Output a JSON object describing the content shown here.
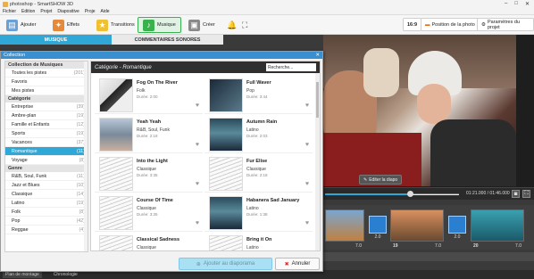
{
  "window": {
    "title": "photoshop - SmartSHOW 3D",
    "controls": [
      "–",
      "□",
      "✕"
    ]
  },
  "menu": [
    "Fichier",
    "Edition",
    "Projet",
    "Diapositive",
    "Proje",
    "Aide"
  ],
  "toolbar": {
    "buttons": [
      {
        "label": "Ajouter",
        "icon": "folder-icon"
      },
      {
        "label": "Effets",
        "icon": "effects-icon"
      },
      {
        "label": "Transitions",
        "icon": "transitions-icon"
      },
      {
        "label": "Musique",
        "icon": "music-icon"
      },
      {
        "label": "Créer",
        "icon": "create-icon"
      }
    ],
    "ratio": "16:9",
    "photo_position": "Position de la photo",
    "project_settings": "Paramètres du projet"
  },
  "subtabs": {
    "music": "MUSIQUE",
    "voice": "COMMENTAIRES SONORES"
  },
  "preview": {
    "edit_label": "Editer la diapo",
    "time": "01:21.000 / 01:46.000",
    "progress": 0.63
  },
  "timeline": {
    "slides": [
      {
        "num": "",
        "dur": "7.0"
      },
      {
        "num": "19",
        "dur": "7.0"
      },
      {
        "num": "20",
        "dur": "7.0"
      }
    ],
    "transitions": [
      "2.0",
      "2.0",
      "2.0"
    ]
  },
  "bottom_tabs": [
    "Plan de montage",
    "Chronologie"
  ],
  "dialog": {
    "title": "Collection",
    "close": "✕",
    "sections": [
      {
        "header": "Collection de Musiques",
        "items": [
          {
            "label": "Toutes les pistes",
            "count": "(201)"
          },
          {
            "label": "Favoris",
            "count": ""
          },
          {
            "label": "Mes pistes",
            "count": ""
          }
        ]
      },
      {
        "header": "Catégorie",
        "items": [
          {
            "label": "Entreprise",
            "count": "(39)"
          },
          {
            "label": "Ambre-plan",
            "count": "(19)"
          },
          {
            "label": "Famille et Enfants",
            "count": "(12)"
          },
          {
            "label": "Sports",
            "count": "(19)"
          },
          {
            "label": "Vacances",
            "count": "(37)"
          },
          {
            "label": "Romantique",
            "count": "(11)",
            "selected": true
          },
          {
            "label": "Voyage",
            "count": "(8)"
          }
        ]
      },
      {
        "header": "Genre",
        "items": [
          {
            "label": "R&B, Soul, Funk",
            "count": "(11)"
          },
          {
            "label": "Jazz et Blues",
            "count": "(10)"
          },
          {
            "label": "Classique",
            "count": "(14)"
          },
          {
            "label": "Latino",
            "count": "(19)"
          },
          {
            "label": "Folk",
            "count": "(8)"
          },
          {
            "label": "Pop",
            "count": "(42)"
          },
          {
            "label": "Reggae",
            "count": "(4)"
          }
        ]
      }
    ],
    "category_title": "Catégorie - Romantique",
    "search_placeholder": "Recherche...",
    "tracks": [
      {
        "title": "Fog On The River",
        "genre": "Folk",
        "duration": "Durée: 2:00",
        "thumb": "piano"
      },
      {
        "title": "Full Waver",
        "genre": "Pop",
        "duration": "Durée: 3:44",
        "thumb": "dark"
      },
      {
        "title": "Yeah Yeah",
        "genre": "R&B, Soul, Funk",
        "duration": "Durée: 2:18",
        "thumb": "girl"
      },
      {
        "title": "Autumn Rain",
        "genre": "Latino",
        "duration": "Durée: 2:03",
        "thumb": "mountain"
      },
      {
        "title": "Into the Light",
        "genre": "Classique",
        "duration": "Durée: 3:35",
        "thumb": "sheet"
      },
      {
        "title": "Fur Elise",
        "genre": "Classique",
        "duration": "Durée: 2:18",
        "thumb": "sheet"
      },
      {
        "title": "Course Of Time",
        "genre": "Classique",
        "duration": "Durée: 3:35",
        "thumb": "sheet"
      },
      {
        "title": "Habanera Sad January",
        "genre": "Latino",
        "duration": "Durée: 1:38",
        "thumb": "mountain"
      },
      {
        "title": "Classical Sadness",
        "genre": "Classique",
        "duration": "",
        "thumb": "sheet"
      },
      {
        "title": "Bring it On",
        "genre": "Latino",
        "duration": "",
        "thumb": "sheet"
      }
    ],
    "add_button": "Ajouter au diaporama",
    "cancel_button": "Annuler"
  }
}
